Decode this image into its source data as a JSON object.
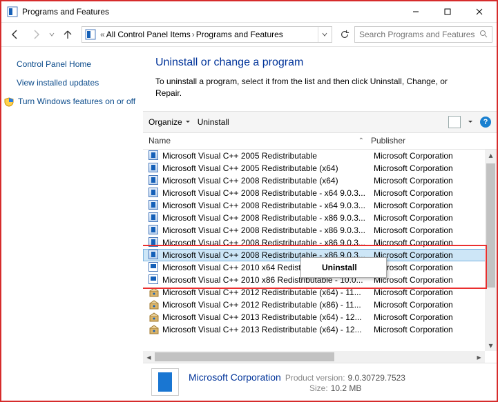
{
  "window": {
    "title": "Programs and Features"
  },
  "breadcrumb": {
    "root": "All Control Panel Items",
    "current": "Programs and Features"
  },
  "search": {
    "placeholder": "Search Programs and Features"
  },
  "sidebar": {
    "home": "Control Panel Home",
    "installed": "View installed updates",
    "wfeatures": "Turn Windows features on or off"
  },
  "heading": "Uninstall or change a program",
  "description": "To uninstall a program, select it from the list and then click Uninstall, Change, or Repair.",
  "toolbar": {
    "organize": "Organize",
    "uninstall": "Uninstall"
  },
  "columns": {
    "name": "Name",
    "publisher": "Publisher"
  },
  "context_menu": {
    "uninstall": "Uninstall"
  },
  "programs": [
    {
      "name": "Microsoft Visual C++ 2005 Redistributable",
      "publisher": "Microsoft Corporation",
      "icon": "box"
    },
    {
      "name": "Microsoft Visual C++ 2005 Redistributable (x64)",
      "publisher": "Microsoft Corporation",
      "icon": "box"
    },
    {
      "name": "Microsoft Visual C++ 2008 Redistributable (x64)",
      "publisher": "Microsoft Corporation",
      "icon": "box"
    },
    {
      "name": "Microsoft Visual C++ 2008 Redistributable - x64 9.0.3...",
      "publisher": "Microsoft Corporation",
      "icon": "box"
    },
    {
      "name": "Microsoft Visual C++ 2008 Redistributable - x64 9.0.3...",
      "publisher": "Microsoft Corporation",
      "icon": "box"
    },
    {
      "name": "Microsoft Visual C++ 2008 Redistributable - x86 9.0.3...",
      "publisher": "Microsoft Corporation",
      "icon": "box"
    },
    {
      "name": "Microsoft Visual C++ 2008 Redistributable - x86 9.0.3...",
      "publisher": "Microsoft Corporation",
      "icon": "box"
    },
    {
      "name": "Microsoft Visual C++ 2008 Redistributable - x86 9.0.3...",
      "publisher": "Microsoft Corporation",
      "icon": "box"
    },
    {
      "name": "Microsoft Visual C++ 2008 Redistributable - x86 9.0.3...",
      "publisher": "Microsoft Corporation",
      "icon": "box"
    },
    {
      "name": "Microsoft Visual C++ 2010  x64 Redistributable - 10.0...",
      "publisher": "Microsoft Corporation",
      "icon": "file"
    },
    {
      "name": "Microsoft Visual C++ 2010  x86 Redistributable - 10.0...",
      "publisher": "Microsoft Corporation",
      "icon": "file"
    },
    {
      "name": "Microsoft Visual C++ 2012 Redistributable (x64) - 11...",
      "publisher": "Microsoft Corporation",
      "icon": "msi"
    },
    {
      "name": "Microsoft Visual C++ 2012 Redistributable (x86) - 11...",
      "publisher": "Microsoft Corporation",
      "icon": "msi"
    },
    {
      "name": "Microsoft Visual C++ 2013 Redistributable (x64) - 12...",
      "publisher": "Microsoft Corporation",
      "icon": "msi"
    },
    {
      "name": "Microsoft Visual C++ 2013 Redistributable (x64) - 12...",
      "publisher": "Microsoft Corporation",
      "icon": "msi"
    }
  ],
  "selected_index": 8,
  "details": {
    "publisher": "Microsoft Corporation",
    "version_label": "Product version:",
    "version": "9.0.30729.7523",
    "size_label": "Size:",
    "size": "10.2 MB"
  }
}
